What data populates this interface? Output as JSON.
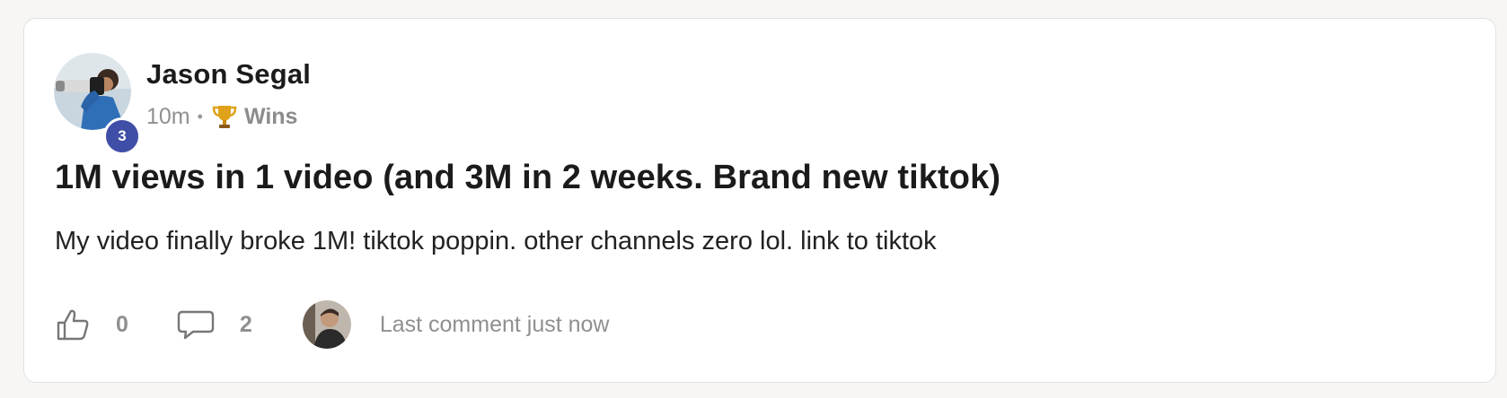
{
  "post": {
    "author": {
      "name": "Jason Segal",
      "level": "3"
    },
    "meta": {
      "time_ago": "10m",
      "separator": "•",
      "category_icon": "trophy-icon",
      "category": "Wins"
    },
    "title": "1M views in 1 video (and 3M in 2 weeks. Brand new tiktok)",
    "body": "My video finally broke 1M! tiktok poppin. other channels zero lol. link to tiktok",
    "footer": {
      "like_icon": "thumbs-up-icon",
      "like_count": "0",
      "comment_icon": "comment-bubble-icon",
      "comment_count": "2",
      "last_comment_text": "Last comment just now"
    }
  },
  "colors": {
    "badge": "#3f4ea6",
    "text_primary": "#1b1b1b",
    "text_muted": "#8f8f8f",
    "background": "#f7f6f4",
    "card": "#ffffff"
  }
}
